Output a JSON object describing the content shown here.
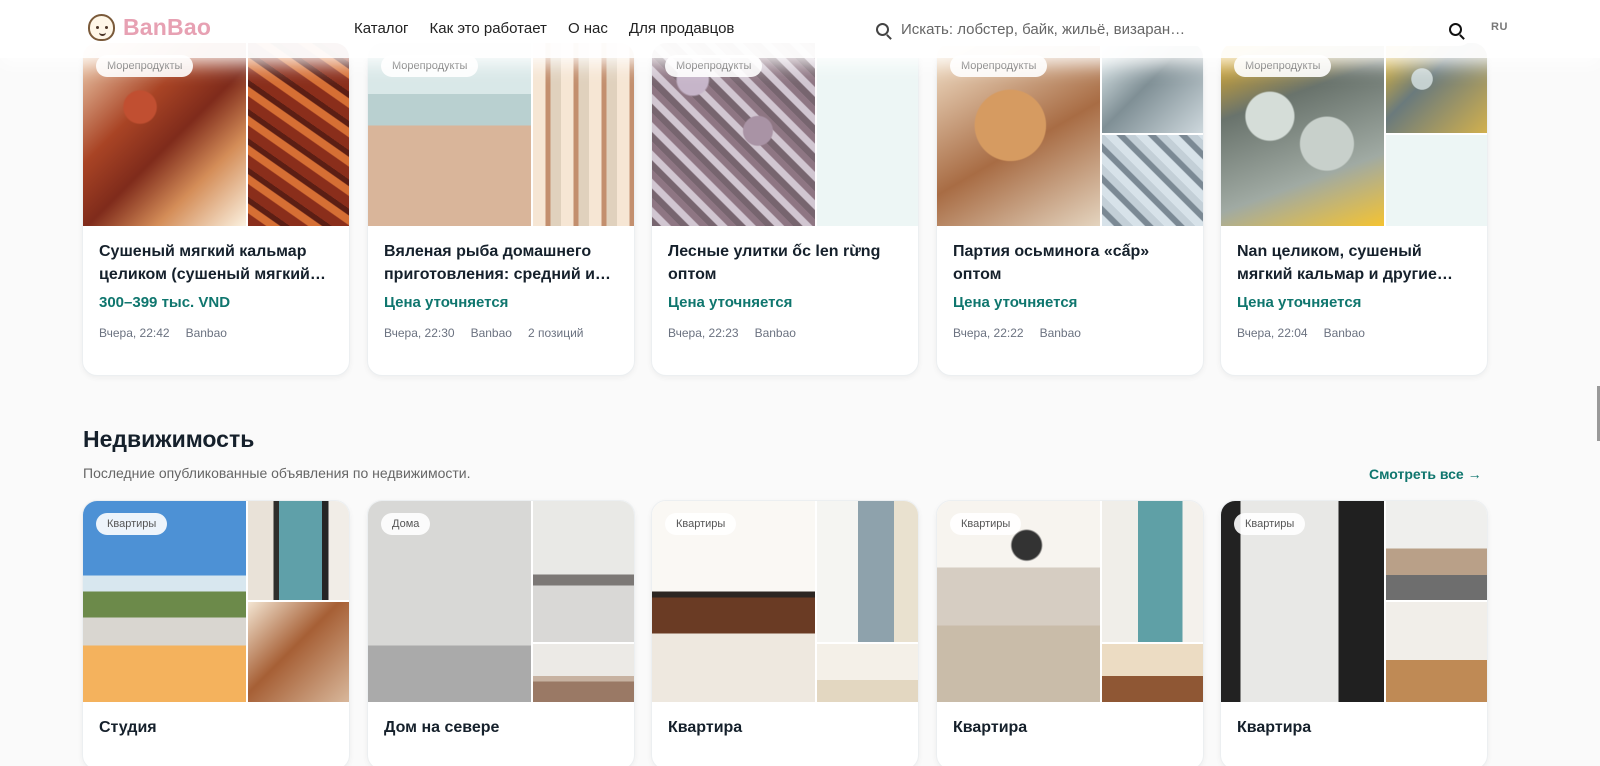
{
  "header": {
    "logo": "BanBao",
    "nav": [
      "Каталог",
      "Как это работает",
      "О нас",
      "Для продавцов"
    ],
    "search_placeholder": "Искать: лобстер, байк, жильё, визаран…",
    "language": "RU"
  },
  "seafood_cards": [
    {
      "category": "Морепродукты",
      "title": "Сушеный мягкий кальмар целиком (сушеный мягкий…",
      "price": "300–399 тыс. VND",
      "time": "Вчера, 22:42",
      "seller": "Banbao",
      "extra": ""
    },
    {
      "category": "Морепродукты",
      "title": "Вяленая рыба домашнего приготовления: средний и…",
      "price": "Цена уточняется",
      "time": "Вчера, 22:30",
      "seller": "Banbao",
      "extra": "2 позиций"
    },
    {
      "category": "Морепродукты",
      "title": "Лесные улитки ốc len rừng оптом",
      "price": "Цена уточняется",
      "time": "Вчера, 22:23",
      "seller": "Banbao",
      "extra": ""
    },
    {
      "category": "Морепродукты",
      "title": "Партия осьминога «сấp» оптом",
      "price": "Цена уточняется",
      "time": "Вчера, 22:22",
      "seller": "Banbao",
      "extra": ""
    },
    {
      "category": "Морепродукты",
      "title": "Nan целиком, сушеный мягкий кальмар и другие…",
      "price": "Цена уточняется",
      "time": "Вчера, 22:04",
      "seller": "Banbao",
      "extra": ""
    }
  ],
  "real_estate": {
    "title": "Недвижимость",
    "subtitle": "Последние опубликованные объявления по недвижимости.",
    "see_all": "Смотреть все →",
    "cards": [
      {
        "category": "Квартиры",
        "title": "Студия"
      },
      {
        "category": "Дома",
        "title": "Дом на севере"
      },
      {
        "category": "Квартиры",
        "title": "Квартира"
      },
      {
        "category": "Квартиры",
        "title": "Квартира"
      },
      {
        "category": "Квартиры",
        "title": "Квартира"
      }
    ]
  },
  "colors": {
    "accent": "#0f766e",
    "logo_pink": "#e7a1b3",
    "background": "#fafafa"
  }
}
